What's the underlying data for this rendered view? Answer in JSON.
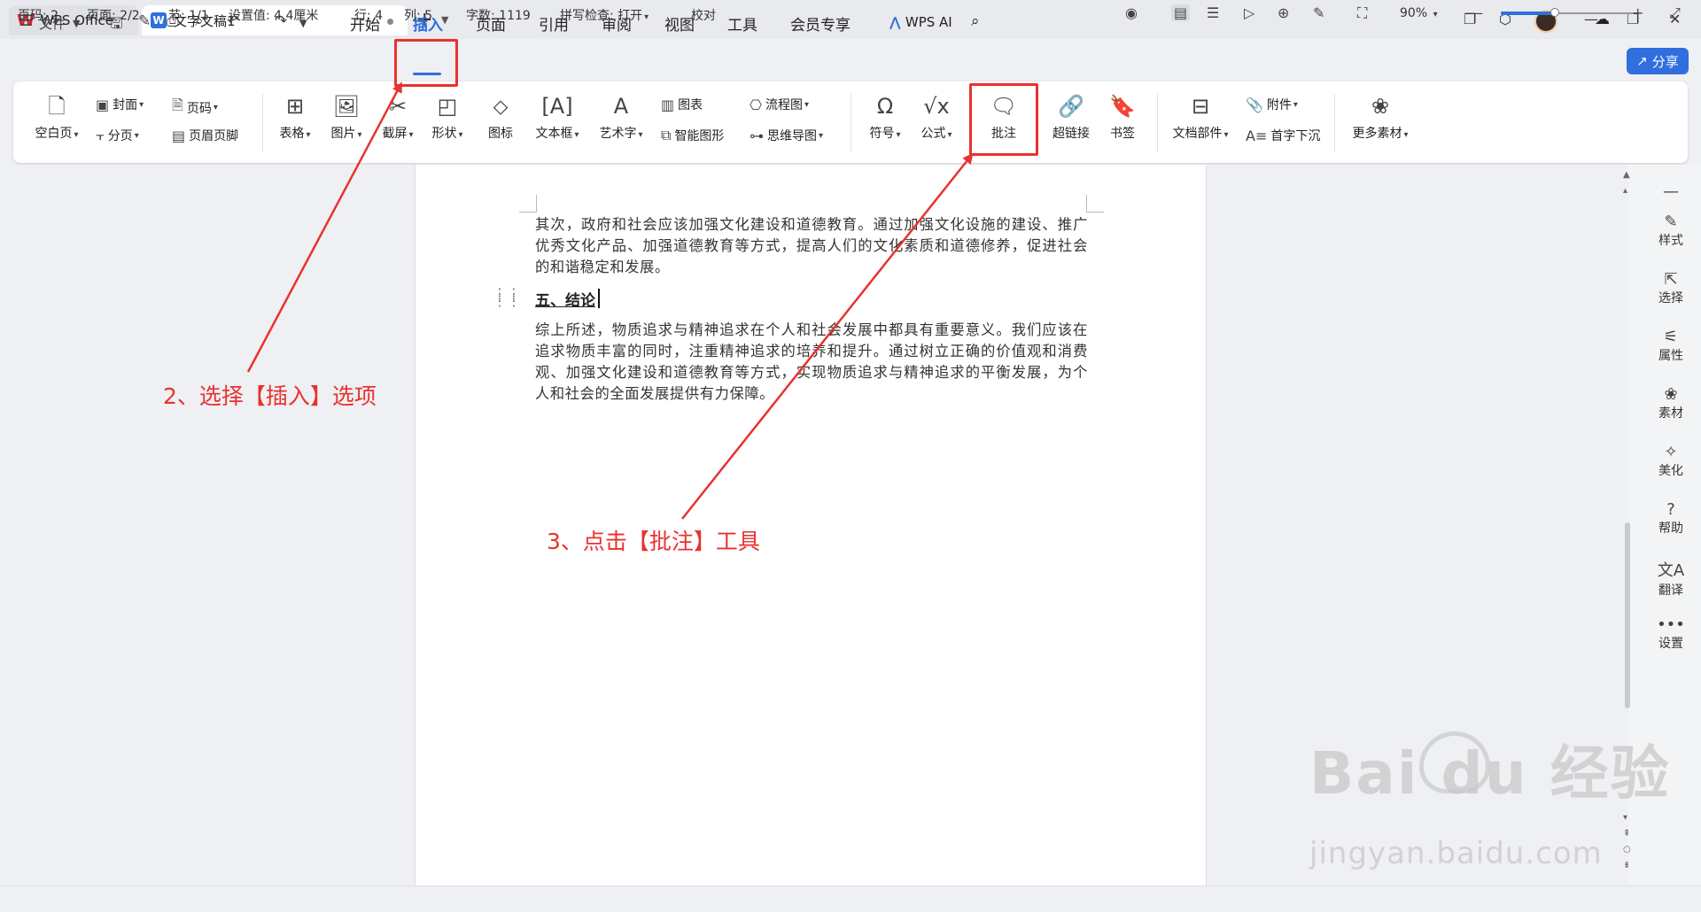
{
  "titlebar": {
    "tabs": [
      {
        "label": "WPS Office",
        "icon": "wps-logo-icon"
      },
      {
        "label": "文字文稿1",
        "icon": "writer-doc-icon"
      }
    ],
    "new_tab_symbol": "+",
    "caret": "⌄"
  },
  "menubar": {
    "file_label": "文件",
    "items": [
      "开始",
      "插入",
      "页面",
      "引用",
      "审阅",
      "视图",
      "工具",
      "会员专享"
    ],
    "active_item": "插入",
    "wps_ai_label": "WPS AI",
    "share_label": "分享",
    "accent_color": "#2f6fde"
  },
  "ribbon": {
    "blank_page": "空白页",
    "cover": "封面",
    "page_break": "分页",
    "page_number": "页码",
    "header_footer": "页眉页脚",
    "table": "表格",
    "picture": "图片",
    "screenshot": "截屏",
    "shape": "形状",
    "icon": "图标",
    "textbox": "文本框",
    "wordart": "艺术字",
    "chart": "图表",
    "smart_graphic": "智能图形",
    "flowchart": "流程图",
    "mindmap": "思维导图",
    "symbol": "符号",
    "formula": "公式",
    "comment": "批注",
    "hyperlink": "超链接",
    "bookmark": "书签",
    "doc_parts": "文档部件",
    "attachment": "附件",
    "drop_cap": "首字下沉",
    "more_material": "更多素材"
  },
  "document": {
    "para1": "其次，政府和社会应该加强文化建设和道德教育。通过加强文化设施的建设、推广优秀文化产品、加强道德教育等方式，提高人们的文化素质和道德修养，促进社会的和谐稳定和发展。",
    "heading": "五、结论",
    "para2": "综上所述，物质追求与精神追求在个人和社会发展中都具有重要意义。我们应该在追求物质丰富的同时，注重精神追求的培养和提升。通过树立正确的价值观和消费观、加强文化建设和道德教育等方式，实现物质追求与精神追求的平衡发展，为个人和社会的全面发展提供有力保障。"
  },
  "annotations": {
    "step2": "2、选择【插入】选项",
    "step3": "3、点击【批注】工具",
    "color": "#e8322e"
  },
  "right_panel": [
    "样式",
    "选择",
    "属性",
    "素材",
    "美化",
    "帮助",
    "翻译",
    "设置"
  ],
  "statusbar": {
    "page_code": "页码: 2",
    "pages": "页面: 2/2",
    "section": "节: 1/1",
    "position": "设置值: 4.4厘米",
    "row": "行: 4",
    "col": "列: 5",
    "word_count": "字数: 1119",
    "spell_check": "拼写检查: 打开",
    "proofread": "校对",
    "zoom": "90%"
  },
  "watermark": {
    "brand": "Bai du 经验",
    "url": "jingyan.baidu.com"
  }
}
